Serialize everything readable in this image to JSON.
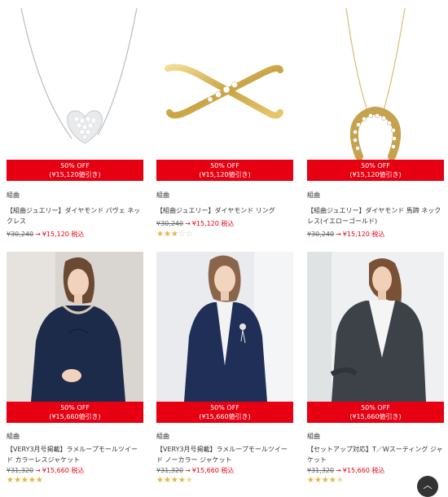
{
  "products": [
    {
      "badge_line1": "50% OFF",
      "badge_line2": "(¥15,120値引き)",
      "brand": "組曲",
      "title": "【組曲ジュエリー】ダイヤモンド パヴェ ネックレス",
      "old_price": "¥30,240",
      "arrow": "→",
      "new_price": "¥15,120 税込",
      "rating": 0,
      "stars": "",
      "image_icon": "heart-necklace"
    },
    {
      "badge_line1": "50% OFF",
      "badge_line2": "(¥15,120値引き)",
      "brand": "組曲",
      "title": "【組曲ジュエリー】ダイヤモンド リング",
      "old_price": "¥30,240",
      "arrow": "→",
      "new_price": "¥15,120 税込",
      "rating": 3,
      "stars": "★★★☆☆",
      "image_icon": "cross-ring"
    },
    {
      "badge_line1": "50% OFF",
      "badge_line2": "(¥15,120値引き)",
      "brand": "組曲",
      "title": "【組曲ジュエリー】ダイヤモンド 馬蹄 ネックレス(イエローゴールド)",
      "old_price": "¥30,240",
      "arrow": "→",
      "new_price": "¥15,120 税込",
      "rating": 0,
      "stars": "",
      "image_icon": "horseshoe-necklace"
    },
    {
      "badge_line1": "50% OFF",
      "badge_line2": "(¥15,660値引き)",
      "brand": "組曲",
      "title": "【VERY3月号掲載】ラメループモールツイード カラーレスジャケット",
      "old_price": "¥31,320",
      "arrow": "→",
      "new_price": "¥15,660 税込",
      "rating": 5,
      "stars": "★★★★★",
      "image_icon": "model-tweed-jacket"
    },
    {
      "badge_line1": "50% OFF",
      "badge_line2": "(¥15,660値引き)",
      "brand": "組曲",
      "title": "【VERY3月号掲載】ラメループモールツイード ノーカラー ジャケット",
      "old_price": "¥31,320",
      "arrow": "→",
      "new_price": "¥15,660 税込",
      "rating": 4.5,
      "stars": "★★★★★",
      "image_icon": "model-nocollar-jacket"
    },
    {
      "badge_line1": "50% OFF",
      "badge_line2": "(¥15,660値引き)",
      "brand": "組曲",
      "title": "【セットアップ対応】T／Wスーティング ジャケット",
      "old_price": "¥31,320",
      "arrow": "→",
      "new_price": "¥15,660 税込",
      "rating": 4.5,
      "stars": "★★★★★",
      "image_icon": "model-suiting-jacket"
    }
  ],
  "scroll_top_icon": "chevron-up-icon",
  "colors": {
    "sale_red": "#e60012",
    "star_gold": "#e4b53b"
  }
}
